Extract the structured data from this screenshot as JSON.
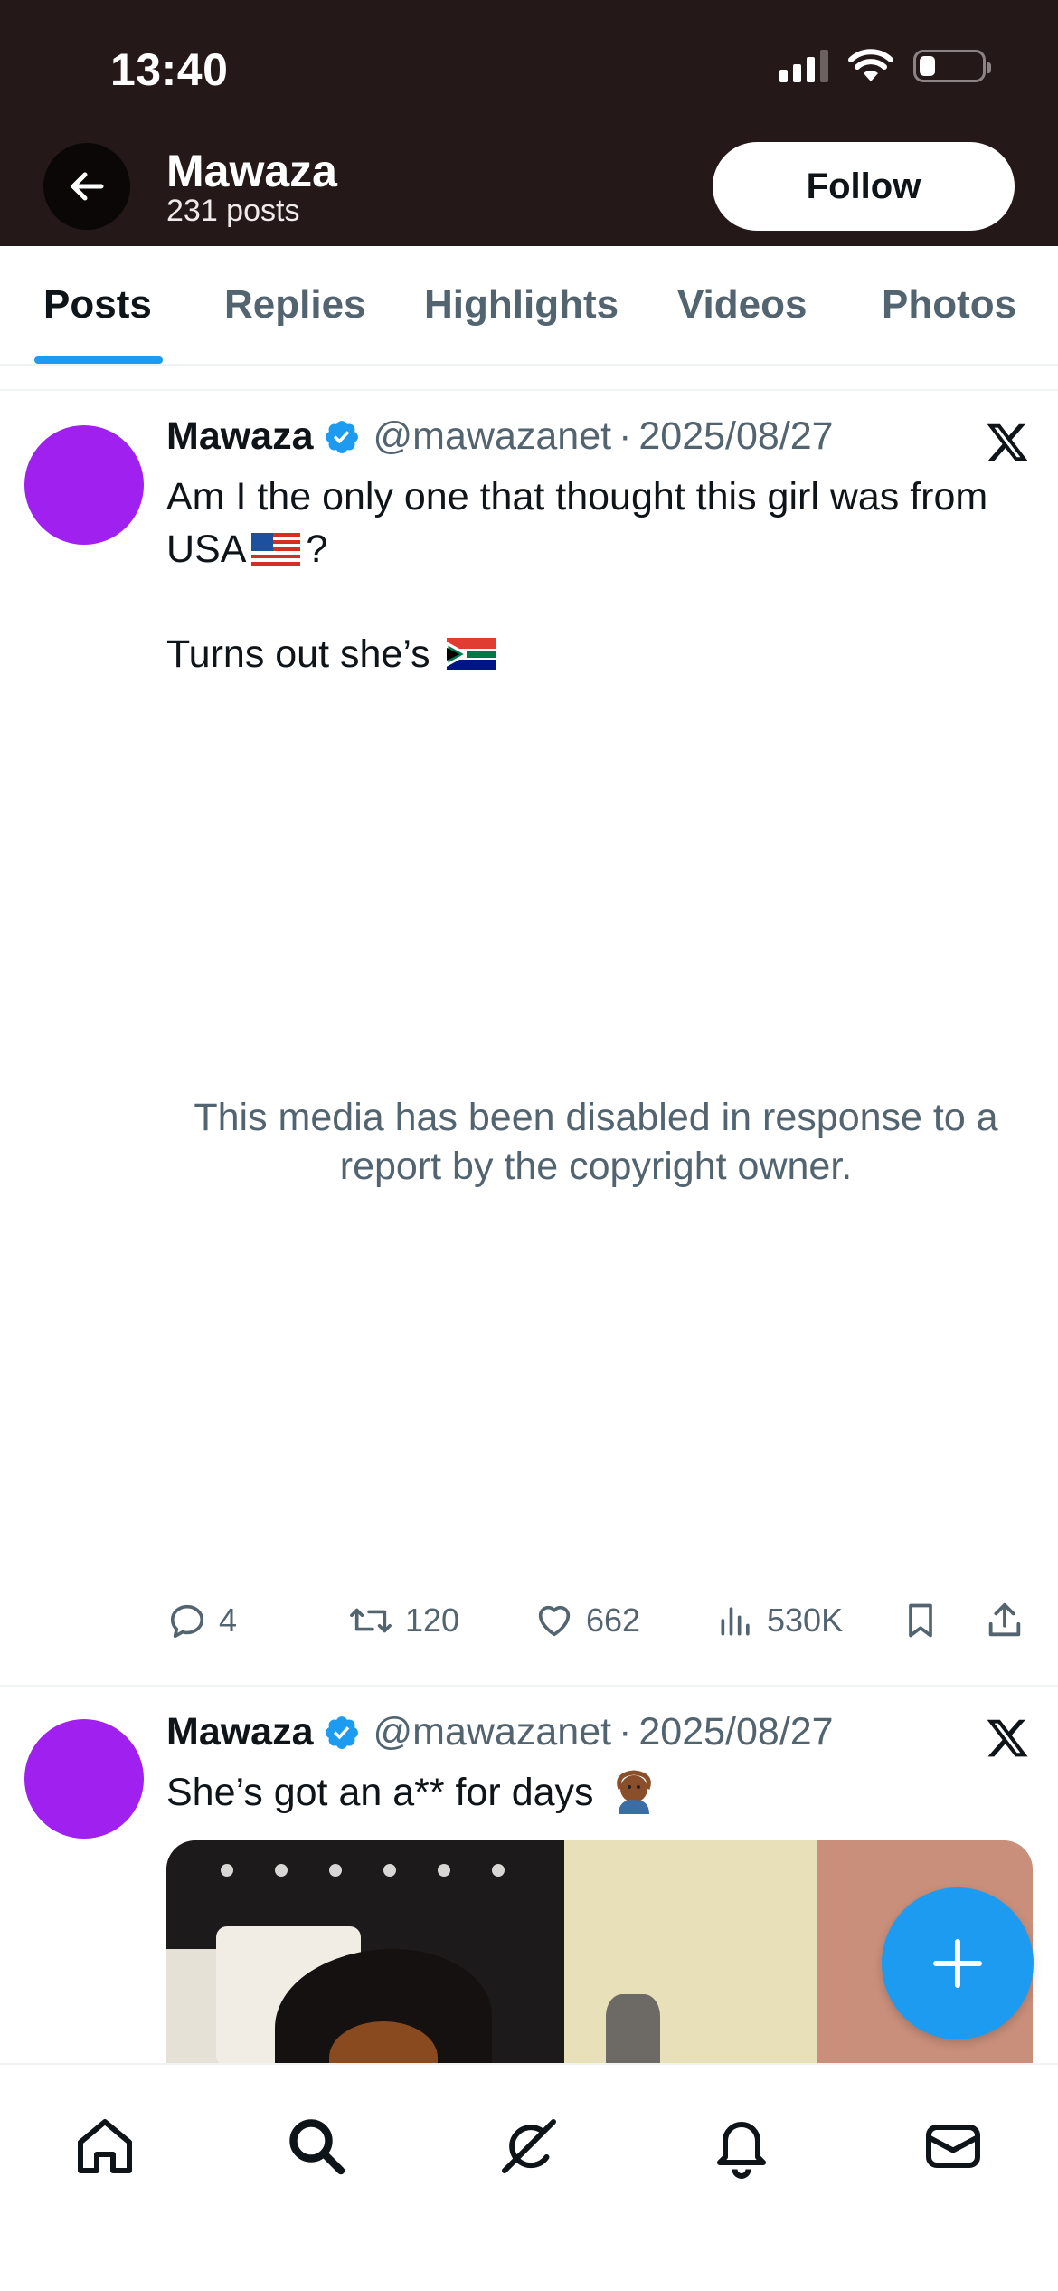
{
  "status_bar": {
    "time": "13:40",
    "icons": [
      "cellular-signal-icon",
      "wifi-icon",
      "battery-icon"
    ]
  },
  "header": {
    "back_icon": "arrow-left-icon",
    "name": "Mawaza",
    "posts_count": "231 posts",
    "follow_label": "Follow",
    "background": "#241818"
  },
  "tabs": [
    {
      "label": "Posts",
      "active": true
    },
    {
      "label": "Replies",
      "active": false
    },
    {
      "label": "Highlights",
      "active": false
    },
    {
      "label": "Videos",
      "active": false
    },
    {
      "label": "Photos",
      "active": false
    }
  ],
  "tweets": [
    {
      "author": "Mawaza",
      "handle": "@mawazanet",
      "separator": "·",
      "date": "2025/08/27",
      "text_line1_before_flag": "Am I the only one that thought this girl was from USA",
      "text_line1_after_flag": "?",
      "text_line2": "Turns out she’s",
      "flags": [
        "us-flag-emoji",
        "south-africa-flag-emoji"
      ],
      "media_notice": "This media has been disabled in response to a report by the copyright owner.",
      "actions": {
        "replies": "4",
        "reposts": "120",
        "likes": "662",
        "views": "530K"
      }
    },
    {
      "author": "Mawaza",
      "handle": "@mawazanet",
      "separator": "·",
      "date": "2025/08/27",
      "text": "She’s got an a** for days",
      "emoji": "person-gesturing-ok-emoji"
    }
  ],
  "fab": {
    "icon": "plus-icon"
  },
  "bottom_nav": [
    "home-icon",
    "search-icon",
    "grok-icon",
    "notifications-bell-icon",
    "messages-envelope-icon"
  ],
  "colors": {
    "accent": "#1d9bf0",
    "avatar": "#a020f0",
    "secondary_text": "#536471",
    "verified": "#1d9bf0"
  }
}
